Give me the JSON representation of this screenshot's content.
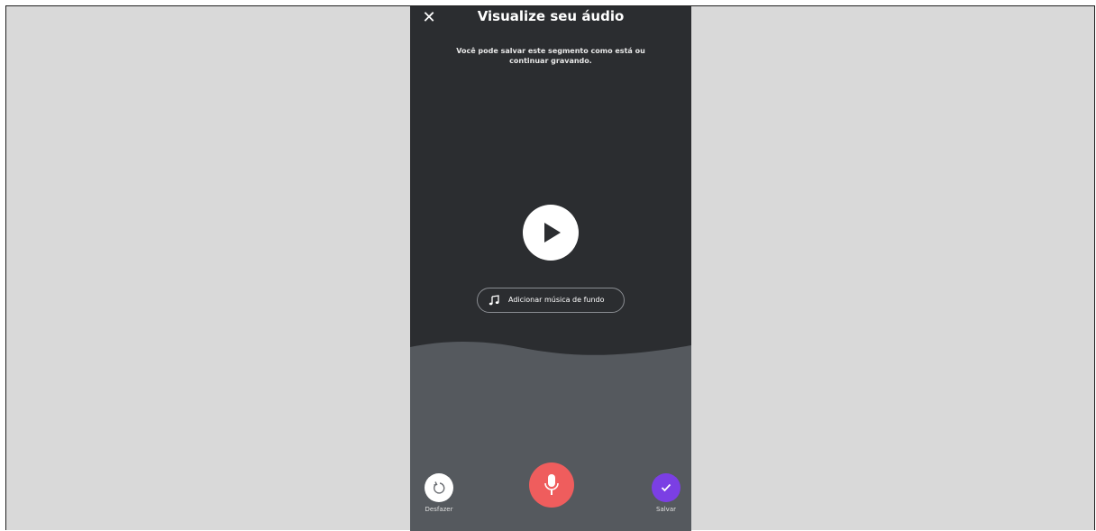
{
  "header": {
    "close_icon": "close-icon",
    "title": "Visualize seu áudio"
  },
  "main": {
    "subtitle": "Você pode salvar este segmento como está ou continuar gravando.",
    "play_icon": "play-icon",
    "music_button": {
      "icon": "music-note-icon",
      "label": "Adicionar música de fundo"
    }
  },
  "footer": {
    "undo": {
      "icon": "undo-icon",
      "label": "Desfazer"
    },
    "record": {
      "icon": "microphone-icon"
    },
    "save": {
      "icon": "check-icon",
      "label": "Salvar"
    }
  },
  "colors": {
    "background": "#d9d9d9",
    "phone_top": "#2b2d30",
    "phone_bottom": "#55595e",
    "record_button": "#ef5d5d",
    "save_button": "#7b3fe4"
  }
}
